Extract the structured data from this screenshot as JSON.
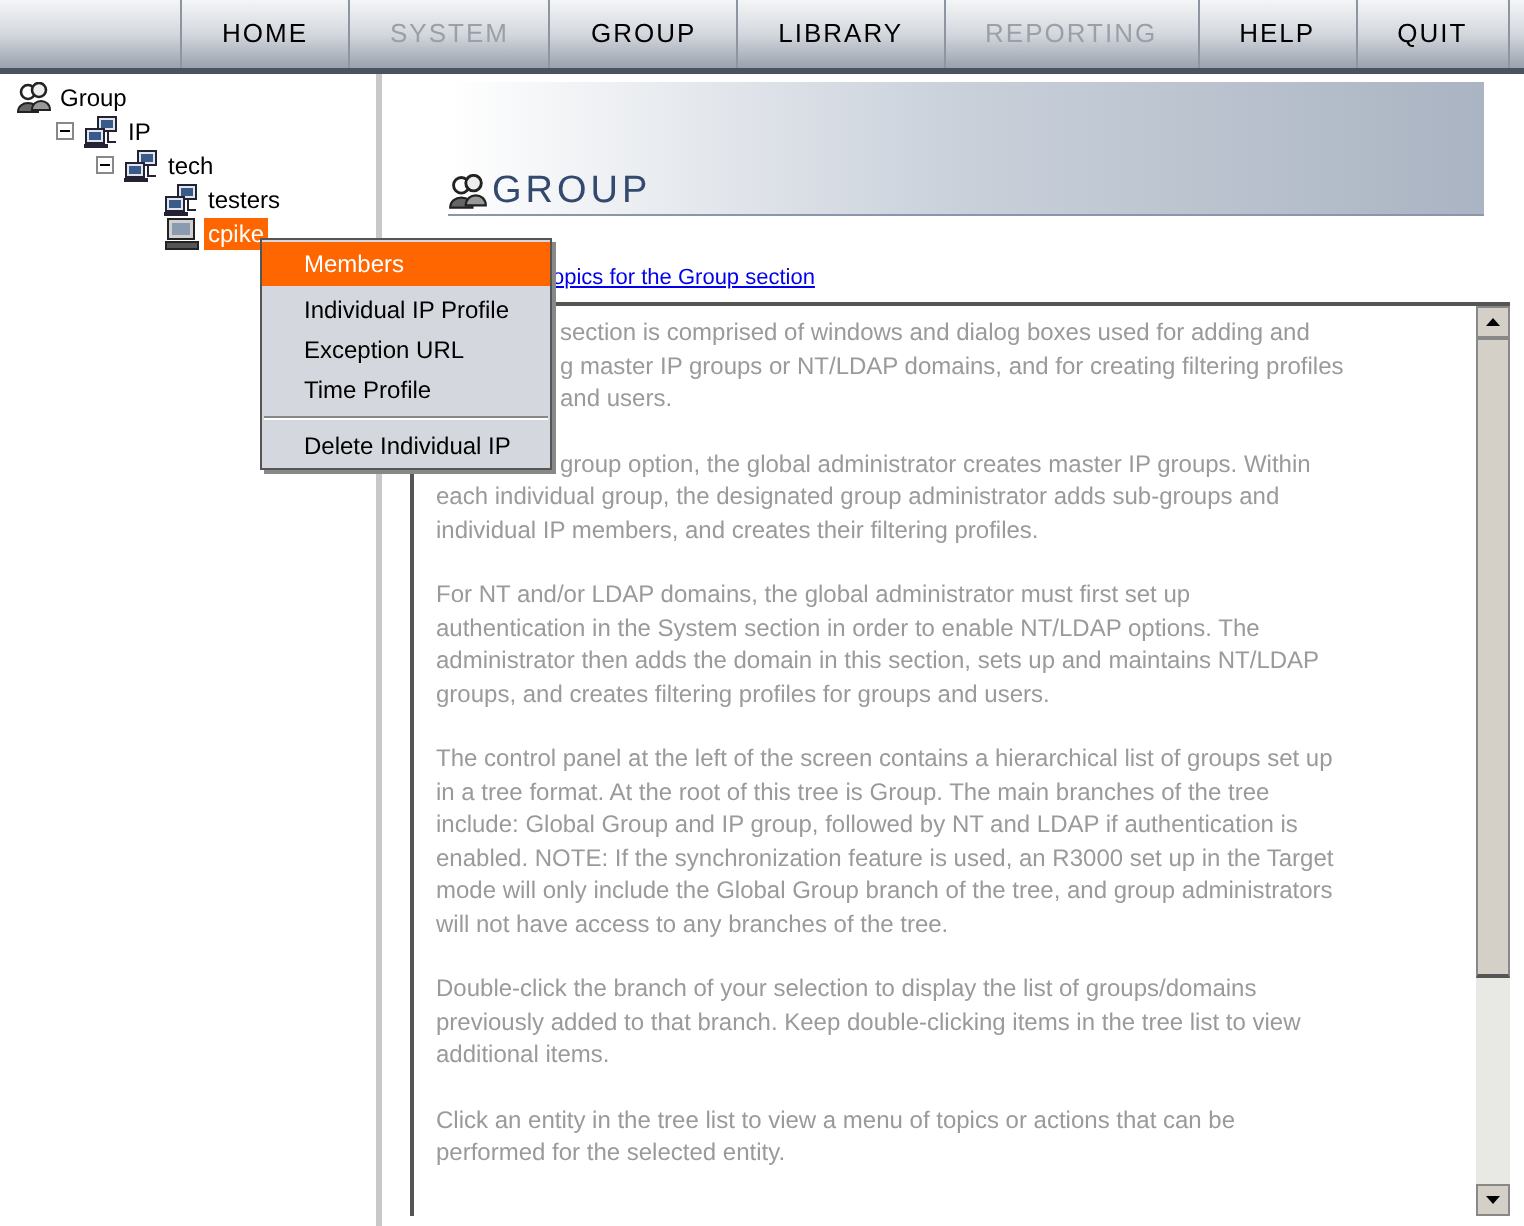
{
  "nav": [
    {
      "label": "HOME",
      "disabled": false
    },
    {
      "label": "SYSTEM",
      "disabled": true
    },
    {
      "label": "GROUP",
      "disabled": false
    },
    {
      "label": "LIBRARY",
      "disabled": false
    },
    {
      "label": "REPORTING",
      "disabled": true
    },
    {
      "label": "HELP",
      "disabled": false
    },
    {
      "label": "QUIT",
      "disabled": false
    }
  ],
  "tree": [
    {
      "label": "Group",
      "kind": "group",
      "expanded": true,
      "selected": false,
      "children": [
        {
          "label": "IP",
          "kind": "network",
          "expanded": true,
          "selected": false,
          "children": [
            {
              "label": "tech",
              "kind": "network",
              "expanded": true,
              "selected": false,
              "children": [
                {
                  "label": "testers",
                  "kind": "network",
                  "selected": false
                },
                {
                  "label": "cpike",
                  "kind": "computer",
                  "selected": true
                }
              ]
            }
          ]
        }
      ]
    }
  ],
  "context_menu": [
    {
      "label": "Members",
      "selected": true,
      "separator_before": false
    },
    {
      "label": "Individual IP Profile",
      "selected": false,
      "separator_before": false
    },
    {
      "label": "Exception URL",
      "selected": false,
      "separator_before": false
    },
    {
      "label": "Time Profile",
      "selected": false,
      "separator_before": false
    },
    {
      "label": "Delete Individual IP",
      "selected": false,
      "separator_before": true
    }
  ],
  "banner": {
    "title": "GROUP"
  },
  "link": "opics for the Group section",
  "help_text": [
    {
      "lines": [
        {
          "text": "section is comprised of windows and dialog boxes used for adding and",
          "covered": true
        },
        {
          "text": "g master IP groups or NT/LDAP domains, and for creating filtering profiles",
          "covered": true
        },
        {
          "text": "and users.",
          "covered": true
        }
      ]
    },
    {
      "lines": [
        {
          "text": "group option, the global administrator creates master IP groups. Within",
          "covered": true
        },
        {
          "text": "each individual group, the designated group administrator adds sub-groups and"
        },
        {
          "text": "individual IP members, and creates their filtering profiles."
        }
      ]
    },
    {
      "lines": [
        {
          "text": "For NT and/or LDAP domains, the global administrator must first set up"
        },
        {
          "text": "authentication in the System section in order to enable NT/LDAP options. The"
        },
        {
          "text": "administrator then adds the domain in this section, sets up and maintains NT/LDAP"
        },
        {
          "text": "groups, and creates filtering profiles for groups and users."
        }
      ]
    },
    {
      "lines": [
        {
          "text": "The control panel at the left of the screen contains a hierarchical list of groups set up"
        },
        {
          "text": "in a tree format. At the root of this tree is Group. The main branches of the tree"
        },
        {
          "text": "include: Global Group and IP group, followed by NT and LDAP if authentication is"
        },
        {
          "text": "enabled. NOTE: If the synchronization feature is used, an R3000 set up in the Target"
        },
        {
          "text": "mode will only include the Global Group branch of the tree, and group administrators"
        },
        {
          "text": "will not have access to any branches of the tree."
        }
      ]
    },
    {
      "lines": [
        {
          "text": "Double-click the branch of your selection to display the list of groups/domains"
        },
        {
          "text": "previously added to that branch. Keep double-clicking items in the tree list to view"
        },
        {
          "text": "additional items."
        }
      ]
    },
    {
      "lines": [
        {
          "text": "Click an entity in the tree list to view a menu of topics or actions that can be"
        },
        {
          "text": "performed for the selected entity."
        }
      ]
    }
  ]
}
